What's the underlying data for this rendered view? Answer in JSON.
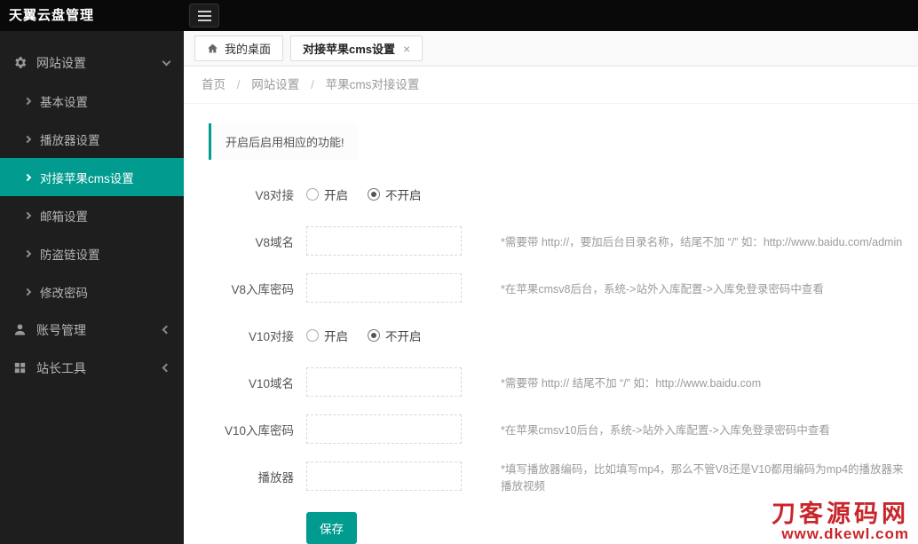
{
  "header": {
    "title": "天翼云盘管理"
  },
  "sidebar": {
    "groups": [
      {
        "label": "网站设置",
        "expanded": true
      },
      {
        "label": "账号管理",
        "expanded": false
      },
      {
        "label": "站长工具",
        "expanded": false
      }
    ],
    "items": [
      {
        "label": "基本设置",
        "active": false
      },
      {
        "label": "播放器设置",
        "active": false
      },
      {
        "label": "对接苹果cms设置",
        "active": true
      },
      {
        "label": "邮箱设置",
        "active": false
      },
      {
        "label": "防盗链设置",
        "active": false
      },
      {
        "label": "修改密码",
        "active": false
      }
    ]
  },
  "tabs": {
    "desktop": "我的桌面",
    "active": "对接苹果cms设置",
    "close_glyph": "×"
  },
  "breadcrumb": {
    "items": [
      "首页",
      "网站设置",
      "苹果cms对接设置"
    ],
    "sep": "/"
  },
  "content": {
    "notice": "开启后启用相应的功能!",
    "rows": [
      {
        "label": "V8对接",
        "type": "radio",
        "options": [
          "开启",
          "不开启"
        ],
        "selected": "不开启"
      },
      {
        "label": "V8域名",
        "type": "input",
        "value": "",
        "hint": "*需要带 http://，要加后台目录名称，结尾不加 “/” 如：http://www.baidu.com/admin"
      },
      {
        "label": "V8入库密码",
        "type": "input",
        "value": "",
        "hint": "*在苹果cmsv8后台，系统->站外入库配置->入库免登录密码中查看"
      },
      {
        "label": "V10对接",
        "type": "radio",
        "options": [
          "开启",
          "不开启"
        ],
        "selected": "不开启"
      },
      {
        "label": "V10域名",
        "type": "input",
        "value": "",
        "hint": "*需要带 http:// 结尾不加 “/” 如：http://www.baidu.com"
      },
      {
        "label": "V10入库密码",
        "type": "input",
        "value": "",
        "hint": "*在苹果cmsv10后台，系统->站外入库配置->入库免登录密码中查看"
      },
      {
        "label": "播放器",
        "type": "input",
        "value": "",
        "hint": "*填写播放器编码，比如填写mp4，那么不管V8还是V10都用编码为mp4的播放器来播放视频"
      }
    ],
    "save_label": "保存"
  },
  "watermark": {
    "line1": "刀客源码网",
    "line2": "www.dkewl.com"
  },
  "colors": {
    "accent": "#019b8f",
    "watermark_red": "#c9262c",
    "topbar": "#090909",
    "sidebar": "#1e1e1e"
  }
}
